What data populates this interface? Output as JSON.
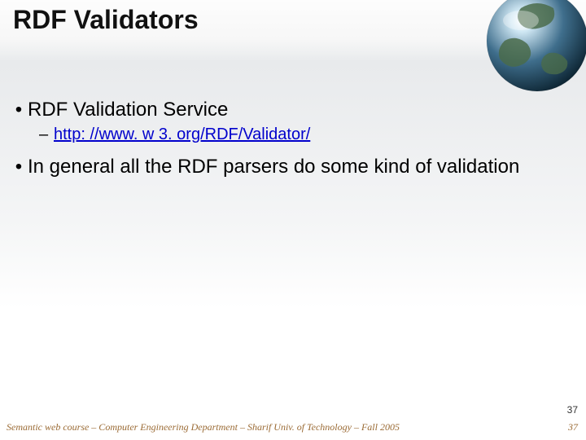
{
  "title": "RDF Validators",
  "bullets": [
    {
      "text": "RDF Validation Service",
      "sub": {
        "link_text": "http: //www. w 3. org/RDF/Validator/"
      }
    },
    {
      "text": "In general all the RDF parsers do some kind of validation"
    }
  ],
  "page_number_top": "37",
  "footer_left": "Semantic web course – Computer Engineering Department – Sharif Univ. of Technology – Fall 2005",
  "footer_right": "37"
}
